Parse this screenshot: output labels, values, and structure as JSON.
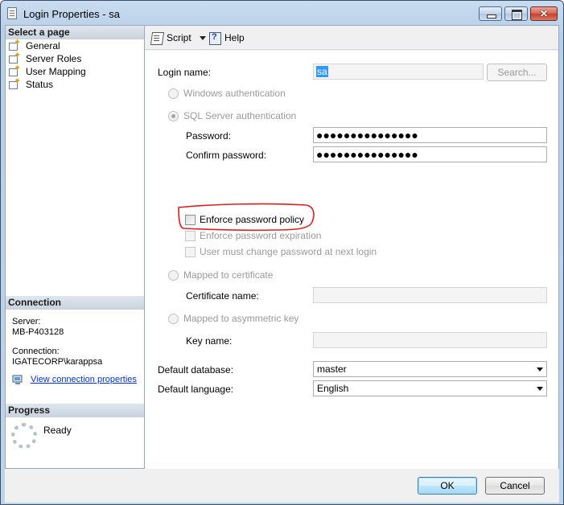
{
  "window": {
    "title": "Login Properties - sa"
  },
  "sidebar": {
    "select_page_header": "Select a page",
    "pages": [
      {
        "label": "General",
        "icon": "page-properties-icon"
      },
      {
        "label": "Server Roles",
        "icon": "page-properties-icon"
      },
      {
        "label": "User Mapping",
        "icon": "page-properties-icon"
      },
      {
        "label": "Status",
        "icon": "page-properties-icon"
      }
    ],
    "connection_header": "Connection",
    "server_label": "Server:",
    "server_value": "MB-P403128",
    "connection_label": "Connection:",
    "connection_value": "IGATECORP\\karappsa",
    "view_connection_link": "View connection properties",
    "progress_header": "Progress",
    "progress_status": "Ready"
  },
  "toolbar": {
    "script_label": "Script",
    "help_label": "Help"
  },
  "form": {
    "login_name_label": "Login name:",
    "login_name_value": "sa",
    "search_button": "Search...",
    "windows_auth": "Windows authentication",
    "sql_auth": "SQL Server authentication",
    "password_label": "Password:",
    "password_value": "●●●●●●●●●●●●●●●",
    "confirm_label": "Confirm password:",
    "confirm_value": "●●●●●●●●●●●●●●●",
    "enforce_policy": "Enforce password policy",
    "enforce_expiration": "Enforce password expiration",
    "must_change": "User must change password at next login",
    "mapped_cert": "Mapped to certificate",
    "cert_name_label": "Certificate name:",
    "mapped_asym": "Mapped to asymmetric key",
    "key_name_label": "Key name:",
    "default_db_label": "Default database:",
    "default_db_value": "master",
    "default_lang_label": "Default language:",
    "default_lang_value": "English"
  },
  "footer": {
    "ok": "OK",
    "cancel": "Cancel"
  },
  "colors": {
    "annotation": "#e02020",
    "link": "#0033cc",
    "selection": "#3399ff"
  }
}
